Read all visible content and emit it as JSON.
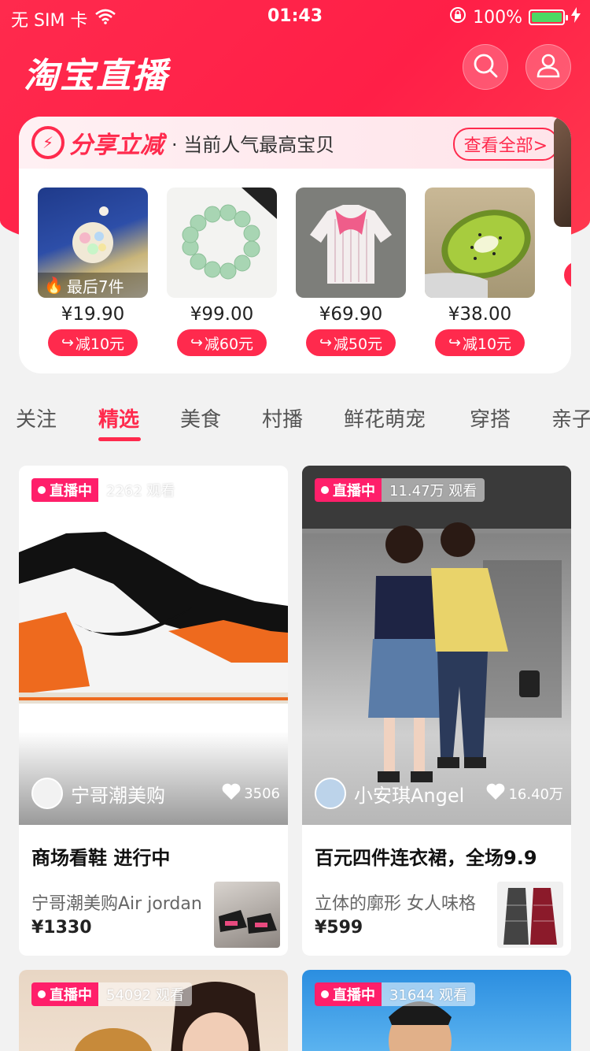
{
  "status_bar": {
    "carrier": "无 SIM 卡",
    "time": "01:43",
    "battery": "100%"
  },
  "header": {
    "title": "淘宝直播"
  },
  "share": {
    "title": "分享立减",
    "subtitle": "· 当前人气最高宝贝",
    "view_all": "查看全部>",
    "products": [
      {
        "price": "¥19.90",
        "reduce": "减10元",
        "badge": "最后7件"
      },
      {
        "price": "¥99.00",
        "reduce": "减60元"
      },
      {
        "price": "¥69.90",
        "reduce": "减50元"
      },
      {
        "price": "¥38.00",
        "reduce": "减10元"
      }
    ]
  },
  "tabs": [
    "关注",
    "精选",
    "美食",
    "村播",
    "鲜花萌宠",
    "穿搭",
    "亲子"
  ],
  "active_tab": "精选",
  "feed": [
    {
      "live_label": "直播中",
      "views": "2262 观看",
      "anchor": "宁哥潮美购",
      "likes": "3506",
      "title": "商场看鞋 进行中",
      "desc": "宁哥潮美购Air jordan",
      "price": "¥1330"
    },
    {
      "live_label": "直播中",
      "views": "11.47万 观看",
      "anchor": "小安琪Angel",
      "likes": "16.40万",
      "title": "百元四件连衣裙，全场9.9",
      "desc": "立体的廓形 女人味格",
      "price": "¥599"
    },
    {
      "live_label": "直播中",
      "views": "54092 观看"
    },
    {
      "live_label": "直播中",
      "views": "31644 观看"
    }
  ],
  "colors": {
    "brand": "#ff2a4d",
    "live": "#ff1f6a"
  }
}
